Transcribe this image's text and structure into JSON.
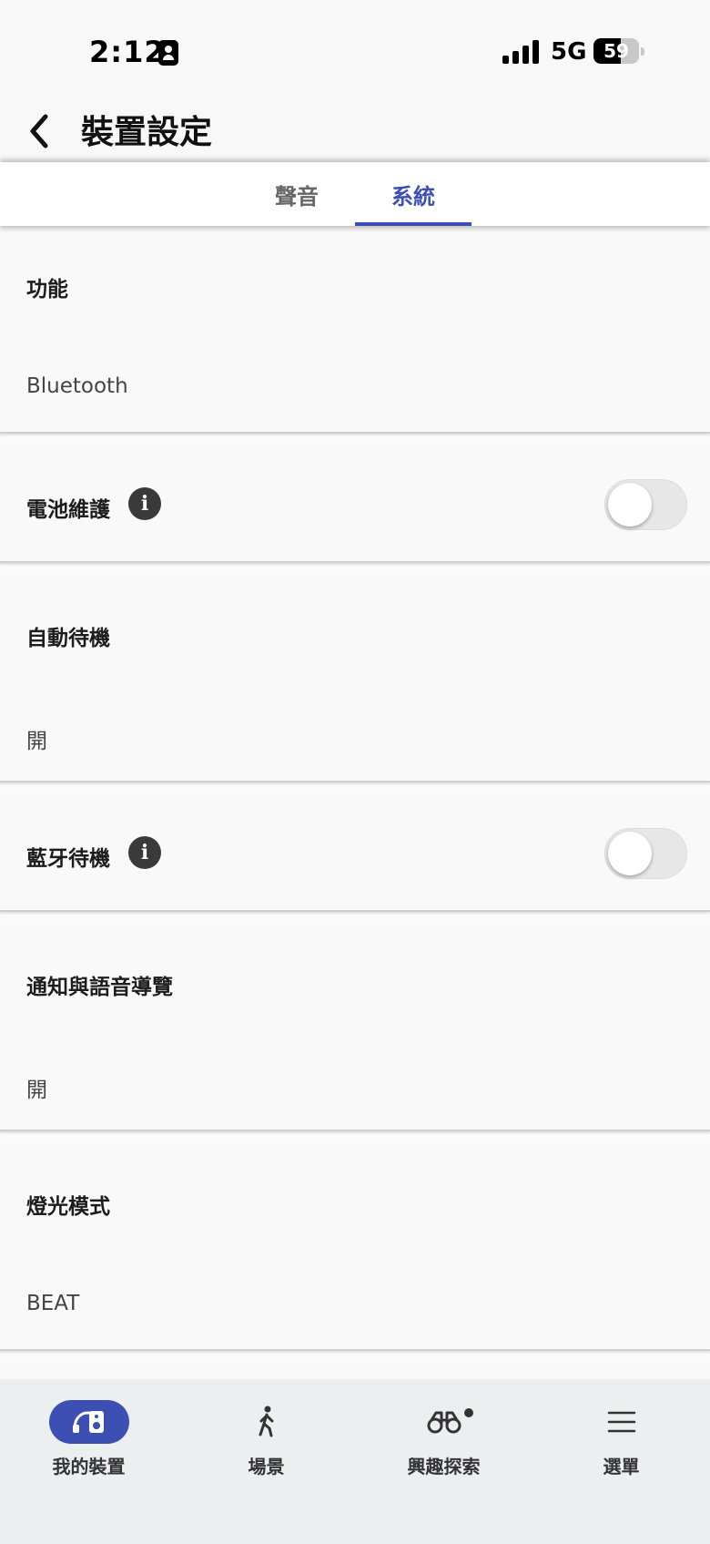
{
  "status_bar": {
    "time": "2:12",
    "network": "5G",
    "battery": "59"
  },
  "header": {
    "title": "裝置設定"
  },
  "tabs": [
    {
      "label": "聲音",
      "active": false
    },
    {
      "label": "系統",
      "active": true
    }
  ],
  "settings": {
    "function": {
      "title": "功能",
      "value": "Bluetooth"
    },
    "battery_care": {
      "title": "電池維護",
      "toggle_on": false
    },
    "auto_standby": {
      "title": "自動待機",
      "value": "開"
    },
    "bt_standby": {
      "title": "藍牙待機",
      "toggle_on": false
    },
    "notify": {
      "title": "通知與語音導覽",
      "value": "開"
    },
    "light_mode": {
      "title": "燈光模式",
      "value": "BEAT"
    }
  },
  "bottom_nav": [
    {
      "label": "我的裝置",
      "icon": "speaker-headphones-icon",
      "active": true
    },
    {
      "label": "場景",
      "icon": "walking-person-icon",
      "active": false
    },
    {
      "label": "興趣探索",
      "icon": "binoculars-icon",
      "active": false
    },
    {
      "label": "選單",
      "icon": "menu-icon",
      "active": false
    }
  ],
  "colors": {
    "accent": "#3d4fb3",
    "background": "#fafafa",
    "nav_background": "#eceff0"
  }
}
